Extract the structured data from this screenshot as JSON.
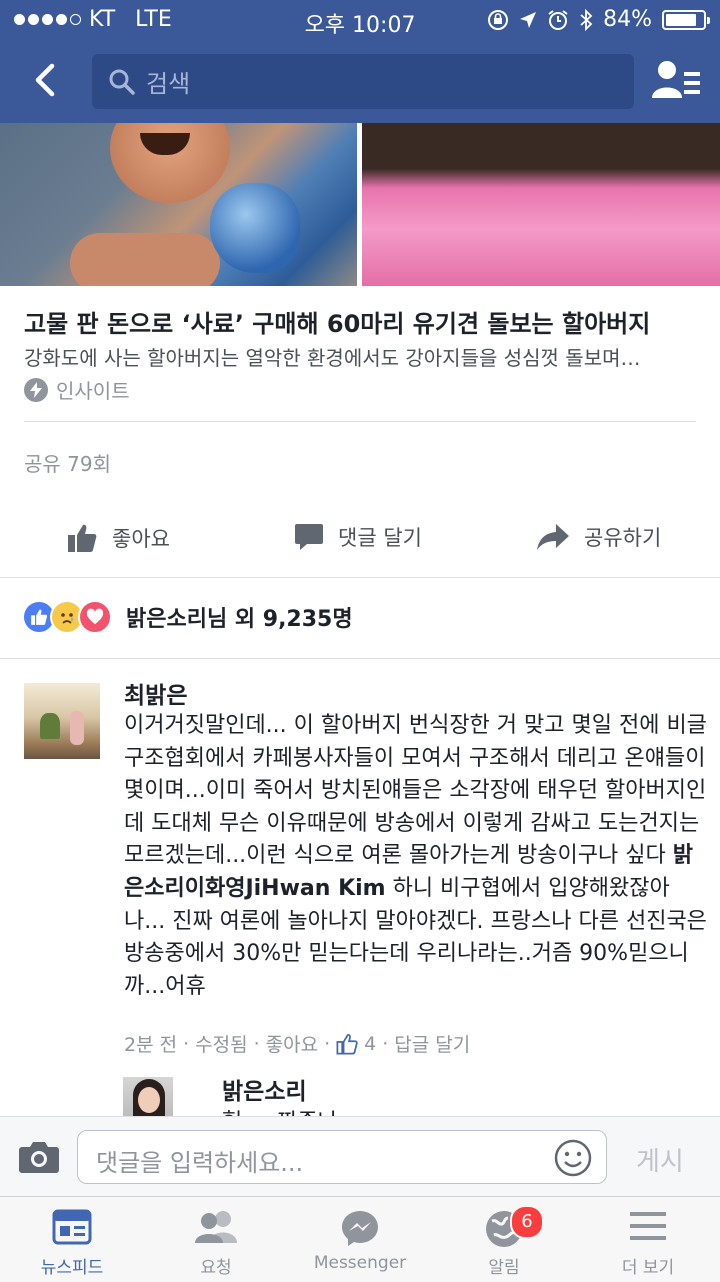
{
  "status_bar": {
    "carrier": "KT",
    "network": "LTE",
    "time": "오후 10:07",
    "battery": "84%",
    "battery_level": 0.84
  },
  "nav": {
    "search_placeholder": "검색"
  },
  "post": {
    "link_title": "고물 판 돈으로 ‘사료’ 구매해 60마리 유기견 돌보는 할아버지",
    "link_description": "강화도에 사는 할아버지는 열악한 환경에서도 강아지들을 성심껏 돌보며…",
    "source": "인사이트",
    "shares": "공유 79회",
    "actions": {
      "like": "좋아요",
      "comment": "댓글 달기",
      "share": "공유하기"
    },
    "reactions_text": "밝은소리님 외 9,235명"
  },
  "comment": {
    "author": "최밝은",
    "text_before": "이거거짓말인데... 이 할아버지 번식장한 거 맞고 몇일 전에 비글구조협회에서 카페봉사자들이 모여서 구조해서 데리고 온얘들이 몇이며...이미 죽어서 방치된얘들은 소각장에 태우던 할아버지인데 도대체 무슨 이유때문에 방송에서 이렇게 감싸고 도는건지는 모르겠는데...이런 식으로 여론 몰아가는게 방송이구나 싶다 ",
    "tag": "밝은소리이화영JiHwan Kim",
    "text_after": " 하니 비구협에서 입양해왔잖아 나... 진짜 여론에 놀아나지 말아야겠다. 프랑스나 다른 선진국은 방송중에서 30%만 믿는다는데 우리나라는..거즘 90%믿으니까...어휴",
    "time": "2분 전",
    "edited": "수정됨",
    "like": "좋아요",
    "like_count": "4",
    "reply": "답글 달기"
  },
  "reply": {
    "author": "밝은소리",
    "peek_text": "헐 ... 짜증나"
  },
  "composer": {
    "placeholder": "댓글을 입력하세요...",
    "post_label": "게시"
  },
  "tabs": [
    {
      "label": "뉴스피드",
      "icon": "news-feed-icon"
    },
    {
      "label": "요청",
      "icon": "friend-requests-icon"
    },
    {
      "label": "Messenger",
      "icon": "messenger-icon"
    },
    {
      "label": "알림",
      "icon": "notifications-globe-icon",
      "badge": "6"
    },
    {
      "label": "더 보기",
      "icon": "menu-icon"
    }
  ],
  "colors": {
    "brand": "#3b5998",
    "active_tab": "#4267b2",
    "badge": "#fa3e3e"
  }
}
